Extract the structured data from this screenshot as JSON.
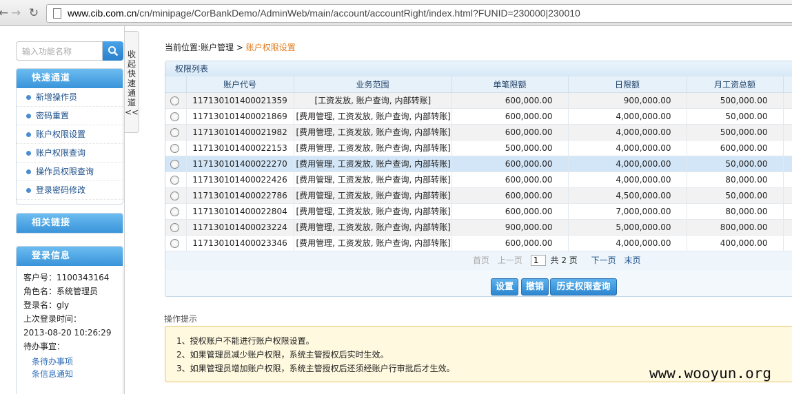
{
  "browser": {
    "url_host": "www.cib.com.cn",
    "url_path": "/cn/minipage/CorBankDemo/AdminWeb/main/account/accountRight/index.html?FUNID=230000|230010"
  },
  "sidebar": {
    "search_placeholder": "输入功能名称",
    "quick": {
      "title": "快速通道",
      "items": [
        "新增操作员",
        "密码重置",
        "账户权限设置",
        "账户权限查询",
        "操作员权限查询",
        "登录密码修改"
      ]
    },
    "links": {
      "title": "相关链接"
    },
    "login": {
      "title": "登录信息",
      "customer_no": "客户号：1100343164",
      "role": "角色名：系统管理员",
      "login_name": "登录名：gly",
      "last_login_label": "上次登录时间：",
      "last_login_time": "2013-08-20 10:26:29",
      "todo_label": "待办事宜：",
      "todo_items": [
        "条待办事项",
        "条信息通知"
      ]
    }
  },
  "collapse": {
    "label": [
      "收",
      "起",
      "快",
      "速",
      "通",
      "道",
      "<<"
    ]
  },
  "main": {
    "breadcrumb_prefix": "当前位置:账户管理 > ",
    "breadcrumb_current": "账户权限设置",
    "grid_title": "权限列表",
    "columns": [
      "账户代号",
      "业务范围",
      "单笔限额",
      "日限额",
      "月工资总额"
    ],
    "rows": [
      {
        "code": "117130101400021359",
        "scope": "[工资发放, 账户查询, 内部转账]",
        "single": "600,000.00",
        "daily": "900,000.00",
        "monthly": "500,000.00"
      },
      {
        "code": "117130101400021869",
        "scope": "[费用管理, 工资发放, 账户查询, 内部转账]",
        "single": "600,000.00",
        "daily": "4,000,000.00",
        "monthly": "50,000.00"
      },
      {
        "code": "117130101400021982",
        "scope": "[费用管理, 工资发放, 账户查询, 内部转账]",
        "single": "600,000.00",
        "daily": "4,000,000.00",
        "monthly": "500,000.00"
      },
      {
        "code": "117130101400022153",
        "scope": "[费用管理, 工资发放, 账户查询, 内部转账]",
        "single": "500,000.00",
        "daily": "4,000,000.00",
        "monthly": "600,000.00"
      },
      {
        "code": "117130101400022270",
        "scope": "[费用管理, 工资发放, 账户查询, 内部转账]",
        "single": "600,000.00",
        "daily": "4,000,000.00",
        "monthly": "50,000.00"
      },
      {
        "code": "117130101400022426",
        "scope": "[费用管理, 工资发放, 账户查询, 内部转账]",
        "single": "600,000.00",
        "daily": "4,000,000.00",
        "monthly": "80,000.00"
      },
      {
        "code": "117130101400022786",
        "scope": "[费用管理, 工资发放, 账户查询, 内部转账]",
        "single": "600,000.00",
        "daily": "4,500,000.00",
        "monthly": "50,000.00"
      },
      {
        "code": "117130101400022804",
        "scope": "[费用管理, 工资发放, 账户查询, 内部转账]",
        "single": "600,000.00",
        "daily": "7,000,000.00",
        "monthly": "80,000.00"
      },
      {
        "code": "117130101400023224",
        "scope": "[费用管理, 工资发放, 账户查询, 内部转账]",
        "single": "900,000.00",
        "daily": "5,000,000.00",
        "monthly": "800,000.00"
      },
      {
        "code": "117130101400023346",
        "scope": "[费用管理, 工资发放, 账户查询, 内部转账]",
        "single": "600,000.00",
        "daily": "4,000,000.00",
        "monthly": "400,000.00"
      }
    ],
    "pager": {
      "first": "首页",
      "prev": "上一页",
      "page": "1",
      "total": "共 2 页",
      "next": "下一页",
      "last": "末页"
    },
    "buttons": {
      "set": "设置",
      "revoke": "撤销",
      "history": "历史权限查询"
    },
    "tips_label": "操作提示",
    "tips": [
      "1、授权账户不能进行账户权限设置。",
      "2、如果管理员减少账户权限，系统主管授权后实时生效。",
      "3、如果管理员增加账户权限，系统主管授权后还须经账户行审批后才生效。"
    ]
  },
  "watermark": "www.wooyun.org"
}
